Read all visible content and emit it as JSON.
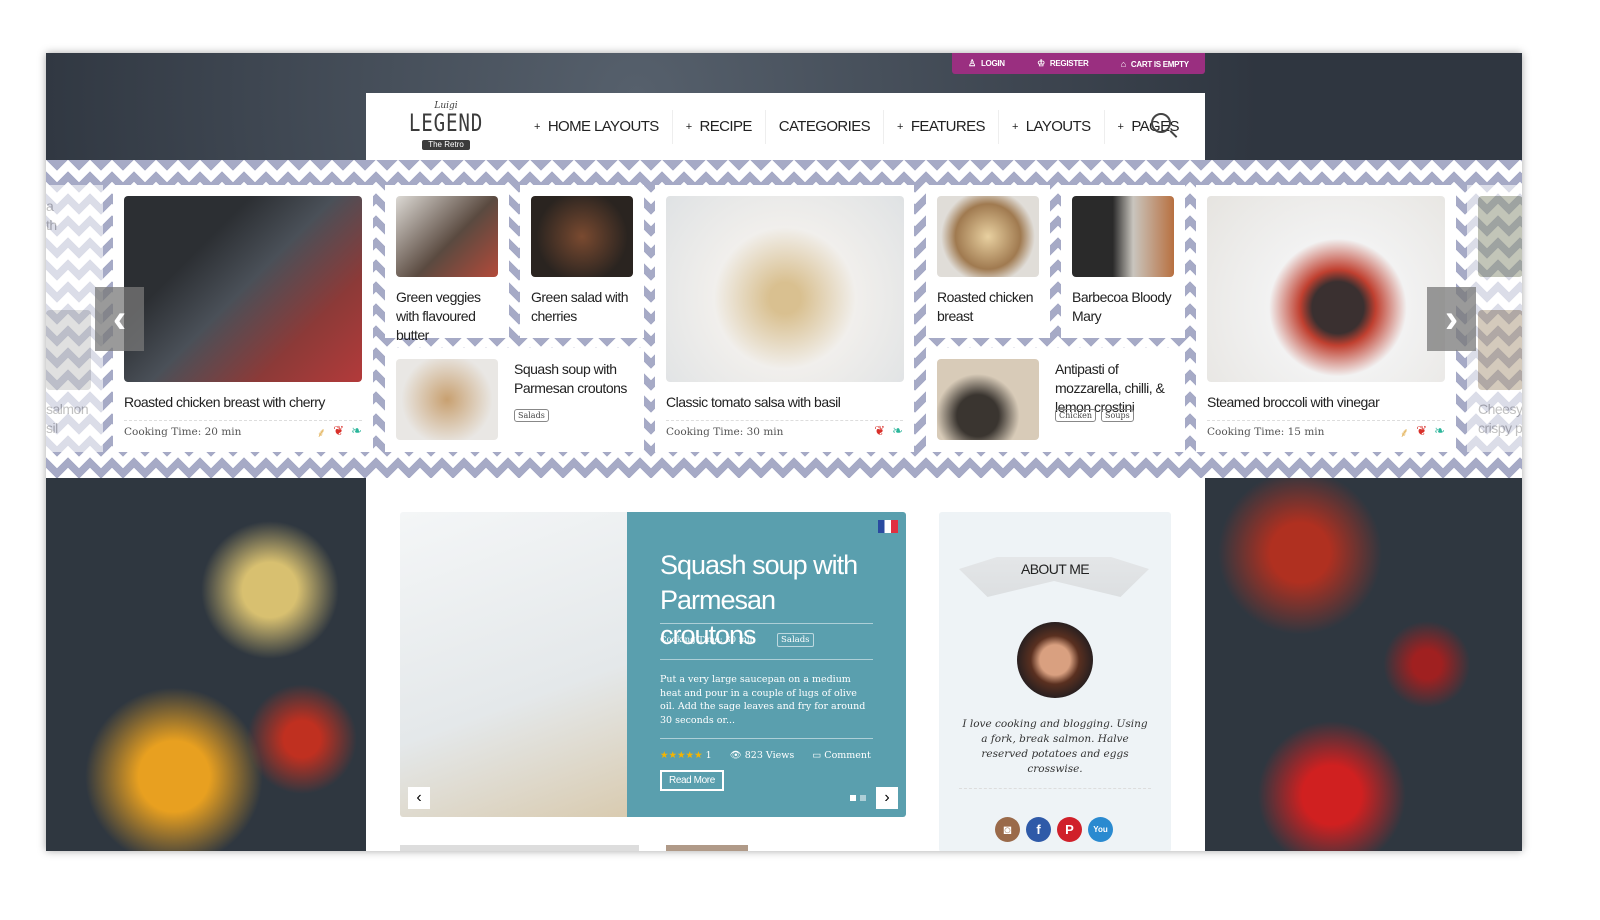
{
  "topbar": {
    "login": "LOGIN",
    "register": "REGISTER",
    "cart": "CART IS EMPTY"
  },
  "logo": {
    "small": "Luigi",
    "main": "LEGEND",
    "ribbon": "The Retro"
  },
  "nav": [
    {
      "label": "HOME LAYOUTS",
      "plus": "+"
    },
    {
      "label": "RECIPE",
      "plus": "+"
    },
    {
      "label": "CATEGORIES",
      "plus": ""
    },
    {
      "label": "FEATURES",
      "plus": "+"
    },
    {
      "label": "LAYOUTS",
      "plus": "+"
    },
    {
      "label": "PAGES",
      "plus": "+"
    }
  ],
  "carousel": {
    "prev": "‹",
    "next": "›",
    "left_partial": {
      "top": "a\nth",
      "bottom": "salmon\nsil"
    },
    "right_partial": {
      "bottom": "Cheesy p\ncrispy pa"
    },
    "cards": [
      {
        "title": "Roasted chicken breast with cherry",
        "time": "Cooking Time: 20 min"
      },
      {
        "title": "Green veggies with flavoured butter"
      },
      {
        "title": "Green salad with cherries"
      },
      {
        "title": "Squash soup with Parmesan croutons",
        "tags": [
          "Salads"
        ]
      },
      {
        "title": "Classic tomato salsa with basil",
        "time": "Cooking Time: 30 min"
      },
      {
        "title": "Roasted chicken breast"
      },
      {
        "title": "Barbecoa Bloody Mary"
      },
      {
        "title": "Antipasti of mozzarella, chilli, & lemon crostini",
        "tags": [
          "Chicken",
          "Soups"
        ]
      },
      {
        "title": "Steamed broccoli with vinegar",
        "time": "Cooking Time: 15 min"
      }
    ]
  },
  "featured": {
    "title": "Squash soup with Parmesan croutons",
    "time": "Cooking Time: 30 min",
    "tag": "Salads",
    "excerpt": "Put a very large saucepan on a medium heat and pour in a couple of lugs of olive oil. Add the sage leaves and fry for around 30 seconds or...",
    "stars": "★★★★★",
    "rating_count": "1",
    "views": "823 Views",
    "comment": "Comment",
    "read_more": "Read More",
    "panel_color": "#5a9fae"
  },
  "about": {
    "title": "ABOUT ME",
    "bio": "I love cooking and blogging. Using a fork, break salmon. Halve reserved potatoes and eggs crosswise."
  },
  "colors": {
    "topbar": "#9a2f80",
    "pattern": "#a6aac6"
  }
}
